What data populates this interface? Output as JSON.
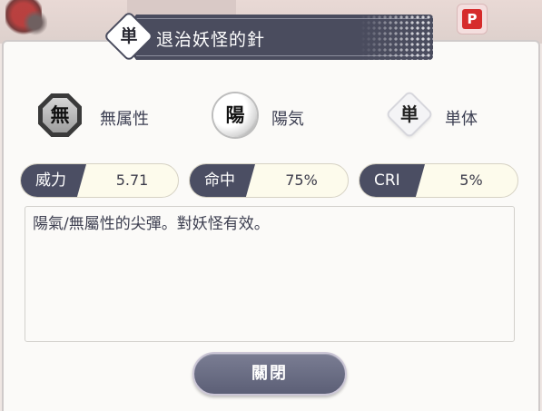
{
  "background": {
    "tab_label": "",
    "p_button_label": "P"
  },
  "dialog": {
    "title_badge": "単",
    "title": "退治妖怪的針",
    "attributes": [
      {
        "icon": "無",
        "label": "無属性",
        "icon_name": "octagon-none-icon"
      },
      {
        "icon": "陽",
        "label": "陽気",
        "icon_name": "yang-circle-icon"
      },
      {
        "icon": "単",
        "label": "単体",
        "icon_name": "single-target-diamond-icon"
      }
    ],
    "stats": [
      {
        "label": "威力",
        "value": "5.71"
      },
      {
        "label": "命中",
        "value": "75%"
      },
      {
        "label": "CRI",
        "value": "5%"
      }
    ],
    "description": "陽氣/無屬性的尖彈。對妖怪有效。",
    "close_label": "關閉"
  },
  "colors": {
    "title_bar": "#4a4c5e",
    "stat_label_bg": "#4b4e63",
    "stat_value_bg": "#fdfbec",
    "button": "#6b6e85",
    "p_button": "#d62b2b"
  }
}
